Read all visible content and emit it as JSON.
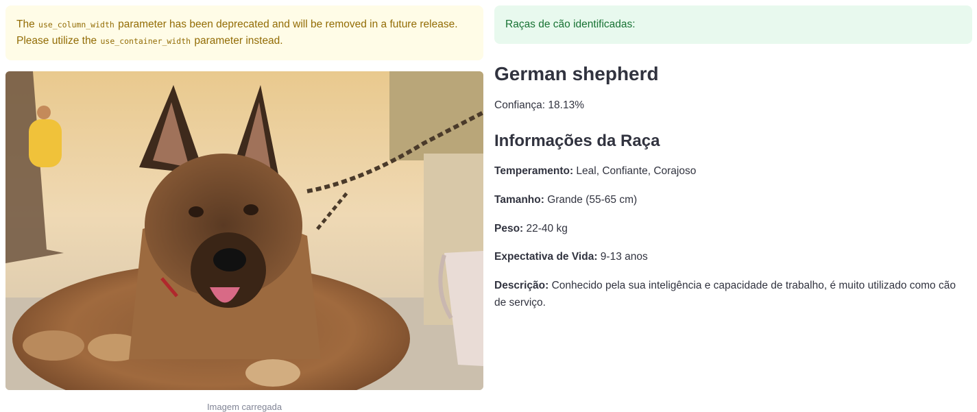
{
  "warning": {
    "line1_pre": "The ",
    "code1": "use_column_width",
    "line1_post": " parameter has been deprecated and will be removed in a future release.",
    "line2_pre": "Please utilize the ",
    "code2": "use_container_width",
    "line2_post": " parameter instead."
  },
  "image": {
    "caption": "Imagem carregada"
  },
  "result": {
    "success_text": "Raças de cão identificadas:",
    "breed": "German shepherd",
    "confidence": "Confiança: 18.13%",
    "info_title": "Informações da Raça",
    "fields": [
      {
        "label": "Temperamento:",
        "value": " Leal, Confiante, Corajoso"
      },
      {
        "label": "Tamanho:",
        "value": " Grande (55-65 cm)"
      },
      {
        "label": "Peso:",
        "value": " 22-40 kg"
      },
      {
        "label": "Expectativa de Vida:",
        "value": " 9-13 anos"
      },
      {
        "label": "Descrição:",
        "value": " Conhecido pela sua inteligência e capacidade de trabalho, é muito utilizado como cão de serviço."
      }
    ]
  },
  "colors": {
    "warning_bg": "#fffce7",
    "warning_text": "#926c05",
    "success_bg": "#e8f9ee",
    "success_text": "#177233",
    "text": "#31333f"
  }
}
